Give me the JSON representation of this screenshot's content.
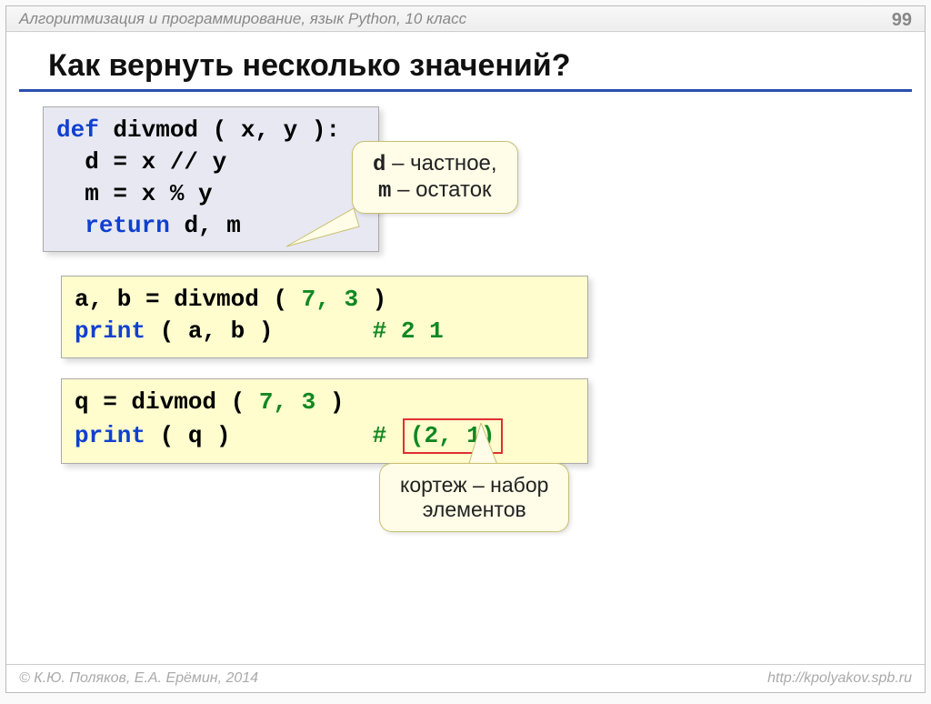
{
  "header": {
    "subject": "Алгоритмизация и программирование, язык Python, 10 класс",
    "page": "99"
  },
  "title": "Как вернуть несколько значений?",
  "code1": {
    "l1_def": "def",
    "l1_rest": " divmod ( x, y ):",
    "l2": "  d = x // y",
    "l3": "  m = x % y",
    "l4_ret": "return",
    "l4_rest": " d, m",
    "l4_indent": "  "
  },
  "callout1": {
    "l1a": "d",
    "l1b": " – частное,",
    "l2a": "m",
    "l2b": " – остаток"
  },
  "code2": {
    "l1a": "a, b = divmod ( ",
    "l1n": "7, 3",
    "l1b": " )",
    "l2a": "print",
    "l2b": " ( a, b )       ",
    "l2c": "# 2 1"
  },
  "code3": {
    "l1a": "q = divmod ( ",
    "l1n": "7, 3",
    "l1b": " )",
    "l2a": "print",
    "l2b": " ( q )          ",
    "l2c": "# ",
    "l2d": "(2, 1)"
  },
  "callout2": {
    "l1": "кортеж – набор",
    "l2": "элементов"
  },
  "footer": {
    "copyright": "© К.Ю. Поляков, Е.А. Ерёмин, 2014",
    "url": "http://kpolyakov.spb.ru"
  }
}
